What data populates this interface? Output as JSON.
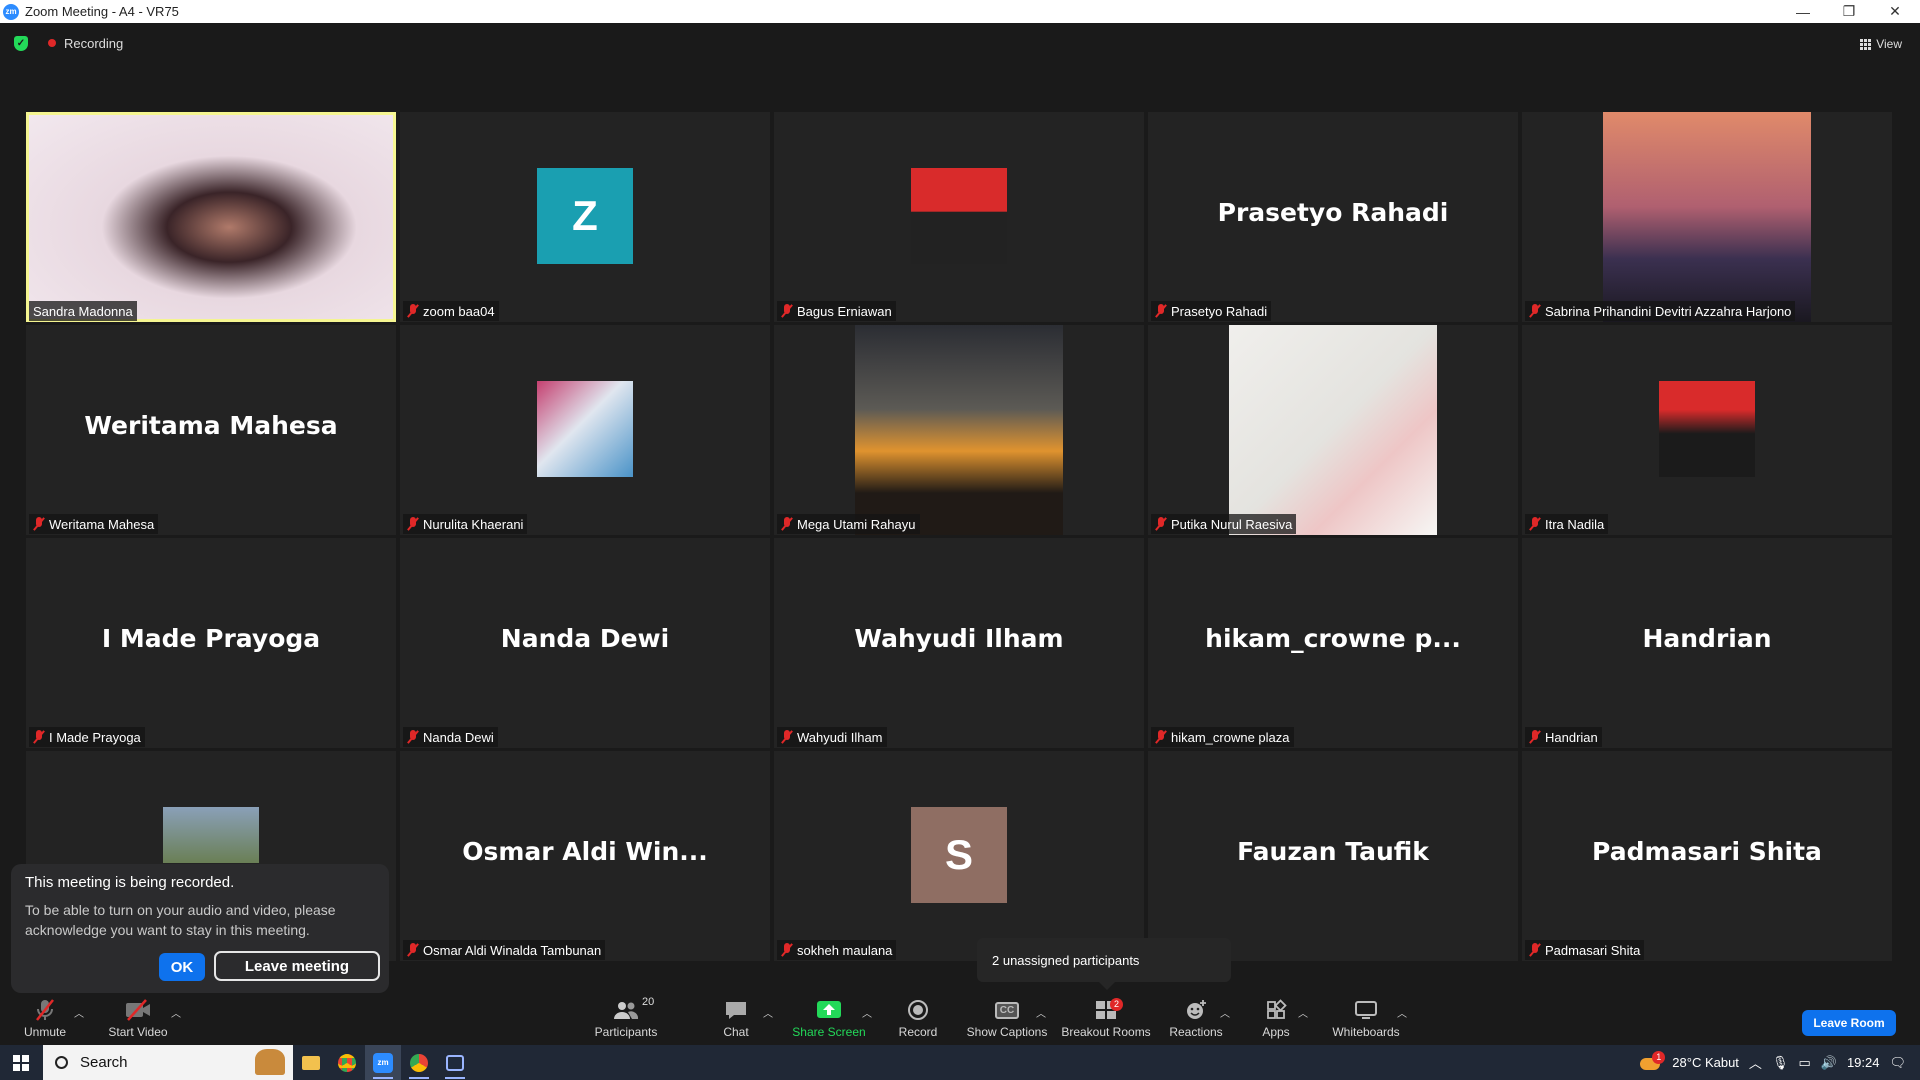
{
  "window": {
    "title": "Zoom Meeting - A4 - VR75",
    "logo_text": "zm",
    "minimize": "—",
    "restore": "❐",
    "close": "✕"
  },
  "topbar": {
    "recording_label": "Recording",
    "view_label": "View"
  },
  "participants": [
    {
      "display": "video",
      "name": "Sandra Madonna",
      "muted": false,
      "active": true
    },
    {
      "display": "avatar",
      "initial": "Z",
      "avatar_color": "#1a9fb1",
      "name": "zoom baa04",
      "muted": true
    },
    {
      "display": "photo",
      "name": "Bagus Erniawan",
      "muted": true
    },
    {
      "display": "text",
      "big_name": "Prasetyo Rahadi",
      "name": "Prasetyo Rahadi",
      "muted": true
    },
    {
      "display": "photo",
      "name": "Sabrina Prihandini Devitri Azzahra Harjono",
      "muted": true
    },
    {
      "display": "text",
      "big_name": "Weritama Mahesa",
      "name": "Weritama Mahesa",
      "muted": true
    },
    {
      "display": "photo",
      "name": "Nurulita Khaerani",
      "muted": true
    },
    {
      "display": "photo",
      "name": "Mega Utami Rahayu",
      "muted": true
    },
    {
      "display": "photo",
      "name": "Putika Nurul Raesiva",
      "muted": true
    },
    {
      "display": "photo",
      "name": "Itra Nadila",
      "muted": true
    },
    {
      "display": "text",
      "big_name": "I Made Prayoga",
      "name": "I Made Prayoga",
      "muted": true
    },
    {
      "display": "text",
      "big_name": "Nanda Dewi",
      "name": "Nanda Dewi",
      "muted": true
    },
    {
      "display": "text",
      "big_name": "Wahyudi Ilham",
      "name": "Wahyudi Ilham",
      "muted": true
    },
    {
      "display": "text",
      "big_name": "hikam_crowne  p...",
      "name": "hikam_crowne plaza",
      "muted": true
    },
    {
      "display": "text",
      "big_name": "Handrian",
      "name": "Handrian",
      "muted": true
    },
    {
      "display": "photo",
      "name": "",
      "muted": true
    },
    {
      "display": "text",
      "big_name": "Osmar  Aldi  Win...",
      "name": "Osmar Aldi Winalda Tambunan",
      "muted": true
    },
    {
      "display": "avatar",
      "initial": "S",
      "avatar_color": "#8f6e63",
      "name": "sokheh maulana",
      "muted": true
    },
    {
      "display": "text",
      "big_name": "Fauzan Taufik",
      "name": "ufik",
      "muted": true
    },
    {
      "display": "text",
      "big_name": "Padmasari Shita",
      "name": "Padmasari Shita",
      "muted": true
    }
  ],
  "recording_popup": {
    "title": "This meeting is being recorded.",
    "message": "To be able to turn on your audio and video, please acknowledge you want to stay in this meeting.",
    "ok_label": "OK",
    "leave_label": "Leave meeting"
  },
  "breakout_tooltip": "2 unassigned participants",
  "toolbar": {
    "unmute": "Unmute",
    "start_video": "Start Video",
    "participants": "Participants",
    "participants_count": "20",
    "chat": "Chat",
    "share_screen": "Share Screen",
    "record": "Record",
    "show_captions": "Show Captions",
    "captions_icon_text": "CC",
    "breakout_rooms": "Breakout Rooms",
    "breakout_badge": "2",
    "reactions": "Reactions",
    "apps": "Apps",
    "whiteboards": "Whiteboards",
    "leave_room": "Leave Room"
  },
  "taskbar": {
    "search_placeholder": "Search",
    "weather": "28°C  Kabut",
    "weather_badge": "1",
    "time": "19:24",
    "zoom_app_text": "zm"
  },
  "colors": {
    "accent_blue": "#0e72ed",
    "muted_red": "#e02828",
    "active_speaker": "#f5f591",
    "share_green": "#23d959"
  }
}
